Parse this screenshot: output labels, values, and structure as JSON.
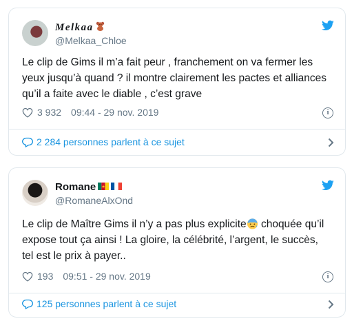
{
  "tweets": [
    {
      "display_name": "Melkaa",
      "handle": "@Melkaa_Chloe",
      "text": "Le clip de Gims il m’a fait peur , franchement on va fermer les\nyeux jusqu’à quand ? il montre clairement les pactes et alliances\nqu’il a faite avec le diable , c’est grave",
      "likes": "3 932",
      "time": "09:44 - 29 nov. 2019",
      "footer": "2 284 personnes parlent à ce sujet"
    },
    {
      "display_name": "Romane",
      "handle": "@RomaneAlxOnd",
      "text_line1": "Le clip de Maître Gims il n’y a pas plus explicite",
      "text_line1b": " choquée qu’il",
      "text_rest": "expose tout ça ainsi ! La gloire, la célébrité, l’argent, le succès,\ntel est le prix à payer..",
      "likes": "193",
      "time": "09:51 - 29 nov. 2019",
      "footer": "125 personnes parlent à ce sujet"
    }
  ],
  "colors": {
    "link": "#1b95e0",
    "muted": "#657786",
    "border": "#e1e8ed",
    "twitter_blue": "#1da1f2"
  },
  "icons": [
    "twitter-bird-icon",
    "heart-icon",
    "info-icon",
    "comment-bubble-icon",
    "chevron-right-icon",
    "teddy-bear-emoji",
    "cameroon-flag",
    "france-flag",
    "anxious-face-emoji"
  ]
}
